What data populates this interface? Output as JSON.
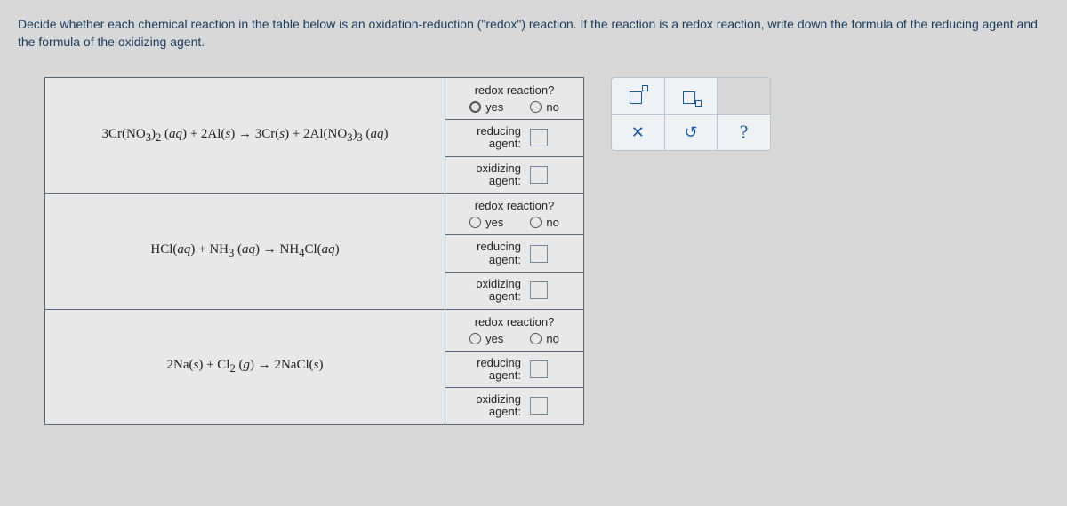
{
  "instructions": "Decide whether each chemical reaction in the table below is an oxidation-reduction (\"redox\") reaction. If the reaction is a redox reaction, write down the formula of the reducing agent and the formula of the oxidizing agent.",
  "headers": {
    "redox_q": "redox reaction?",
    "yes": "yes",
    "no": "no",
    "reducing": "reducing agent:",
    "oxidizing": "oxidizing agent:"
  },
  "reactions": [
    {
      "equation_html": "3Cr(NO<sub>3</sub>)<sub>2</sub> (<i>aq</i>) + 2Al(<i>s</i>) → 3Cr(<i>s</i>) + 2Al(NO<sub>3</sub>)<sub>3</sub> (<i>aq</i>)"
    },
    {
      "equation_html": "HCl(<i>aq</i>) + NH<sub>3</sub> (<i>aq</i>) → NH<sub>4</sub>Cl(<i>aq</i>)"
    },
    {
      "equation_html": "2Na(<i>s</i>) + Cl<sub>2</sub> (<i>g</i>) → 2NaCl(<i>s</i>)"
    }
  ],
  "toolbox": {
    "close": "✕",
    "reset": "↺",
    "help": "?"
  }
}
